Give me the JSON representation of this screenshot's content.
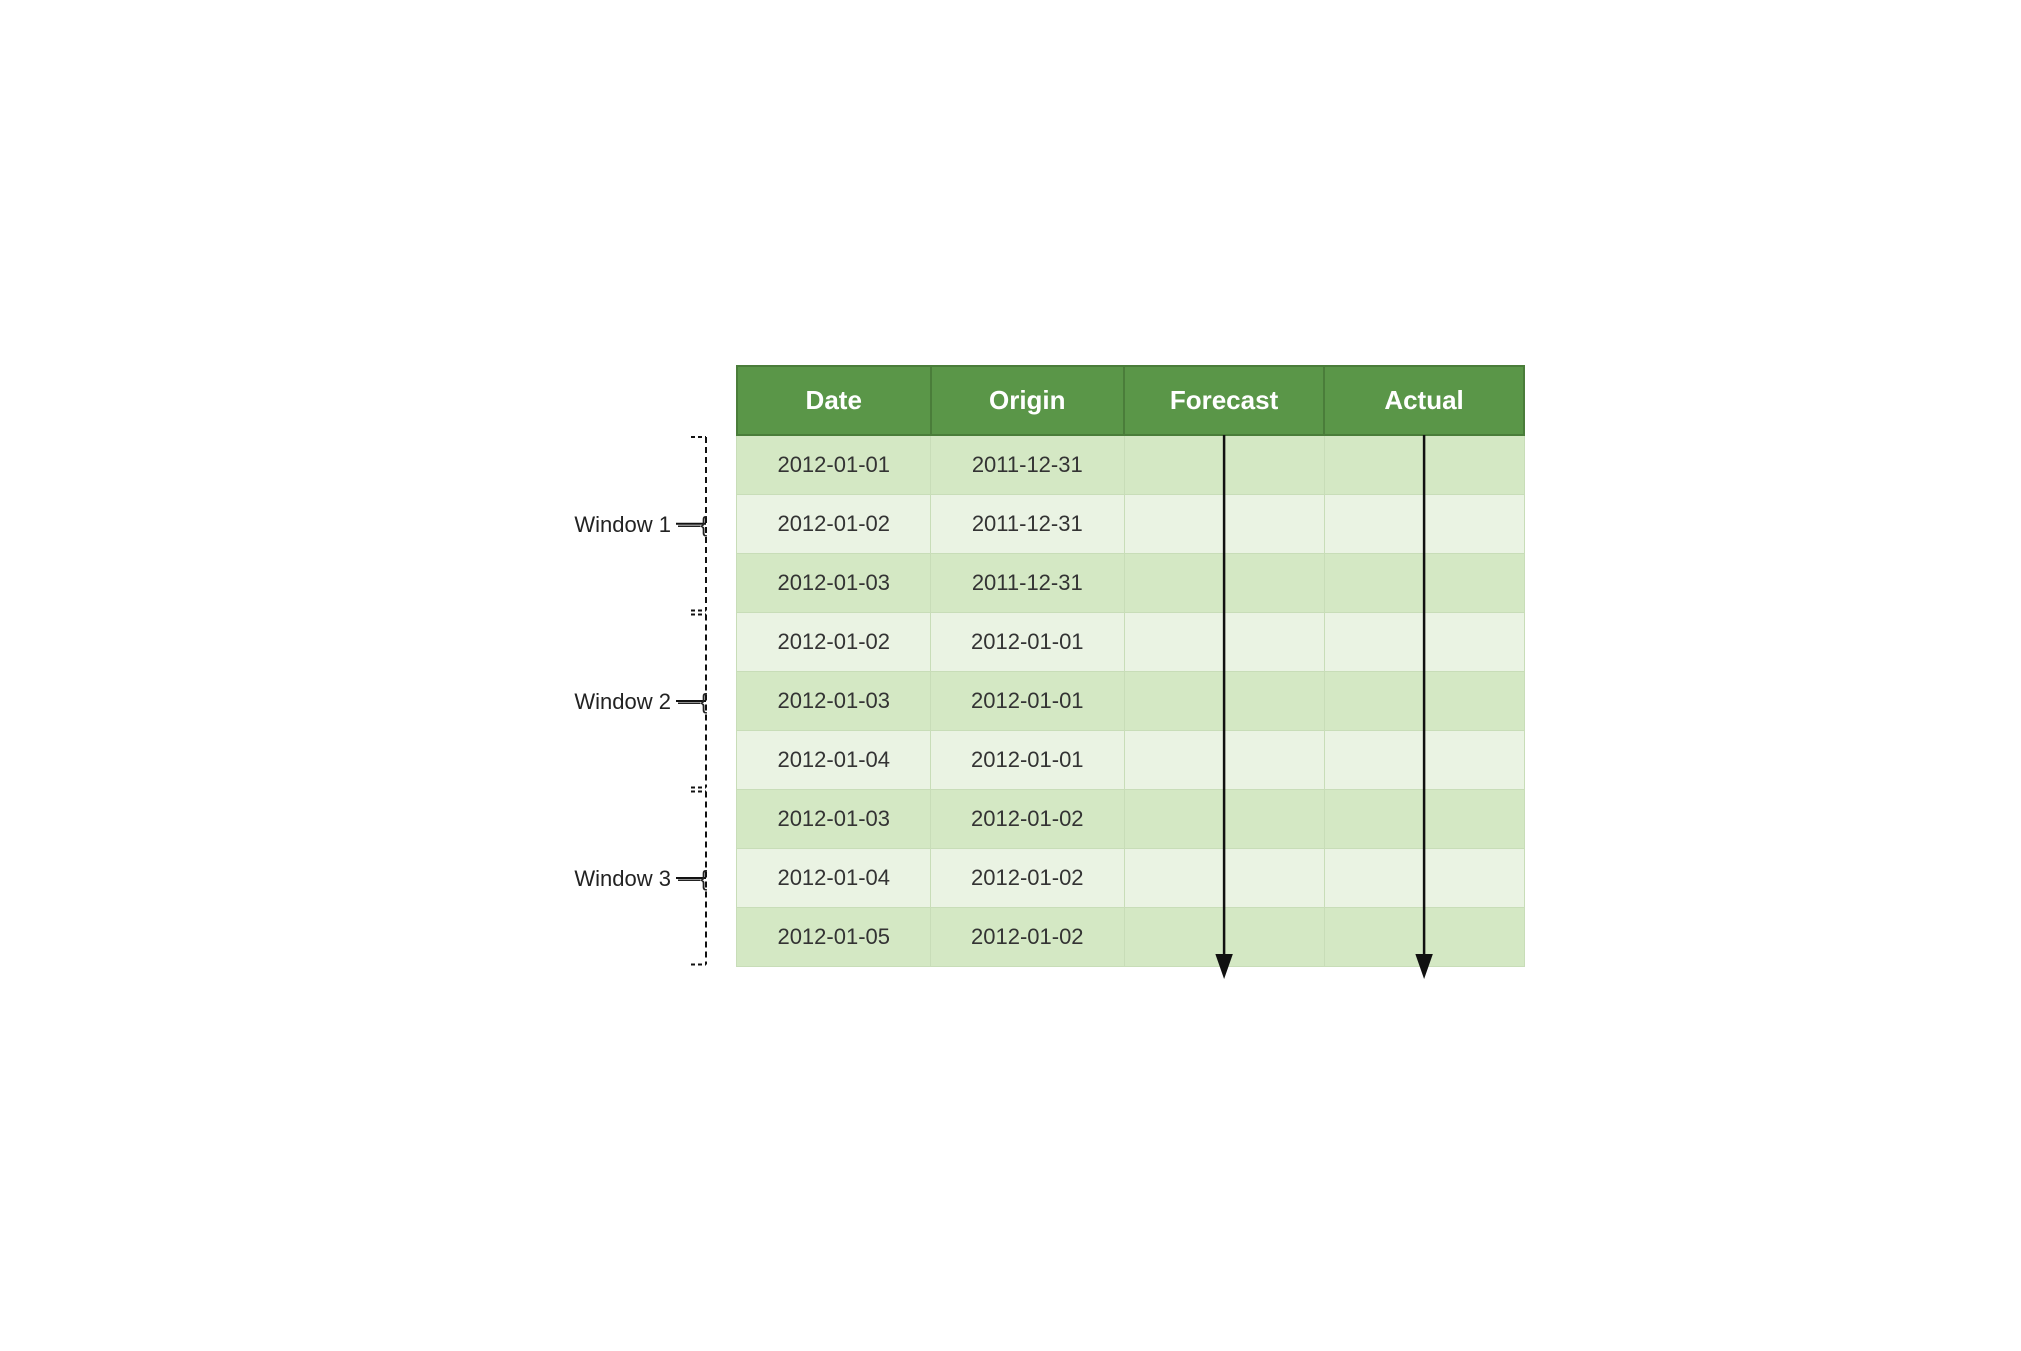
{
  "header": {
    "columns": [
      "Date",
      "Origin",
      "Forecast",
      "Actual"
    ]
  },
  "windows": [
    {
      "label": "Window 1",
      "rows": [
        {
          "date": "2012-01-01",
          "origin": "2011-12-31",
          "shade": "dark"
        },
        {
          "date": "2012-01-02",
          "origin": "2011-12-31",
          "shade": "light"
        },
        {
          "date": "2012-01-03",
          "origin": "2011-12-31",
          "shade": "dark"
        }
      ]
    },
    {
      "label": "Window 2",
      "rows": [
        {
          "date": "2012-01-02",
          "origin": "2012-01-01",
          "shade": "light"
        },
        {
          "date": "2012-01-03",
          "origin": "2012-01-01",
          "shade": "dark"
        },
        {
          "date": "2012-01-04",
          "origin": "2012-01-01",
          "shade": "light"
        }
      ]
    },
    {
      "label": "Window 3",
      "rows": [
        {
          "date": "2012-01-03",
          "origin": "2012-01-02",
          "shade": "dark"
        },
        {
          "date": "2012-01-04",
          "origin": "2012-01-02",
          "shade": "light"
        },
        {
          "date": "2012-01-05",
          "origin": "2012-01-02",
          "shade": "dark"
        }
      ]
    }
  ],
  "colors": {
    "header_bg": "#5a9648",
    "header_text": "#ffffff",
    "row_dark": "#d4e8c4",
    "row_light": "#eaf3e3",
    "border": "#c8ddb8",
    "text": "#333333",
    "arrow": "#111111",
    "bracket": "#111111"
  }
}
